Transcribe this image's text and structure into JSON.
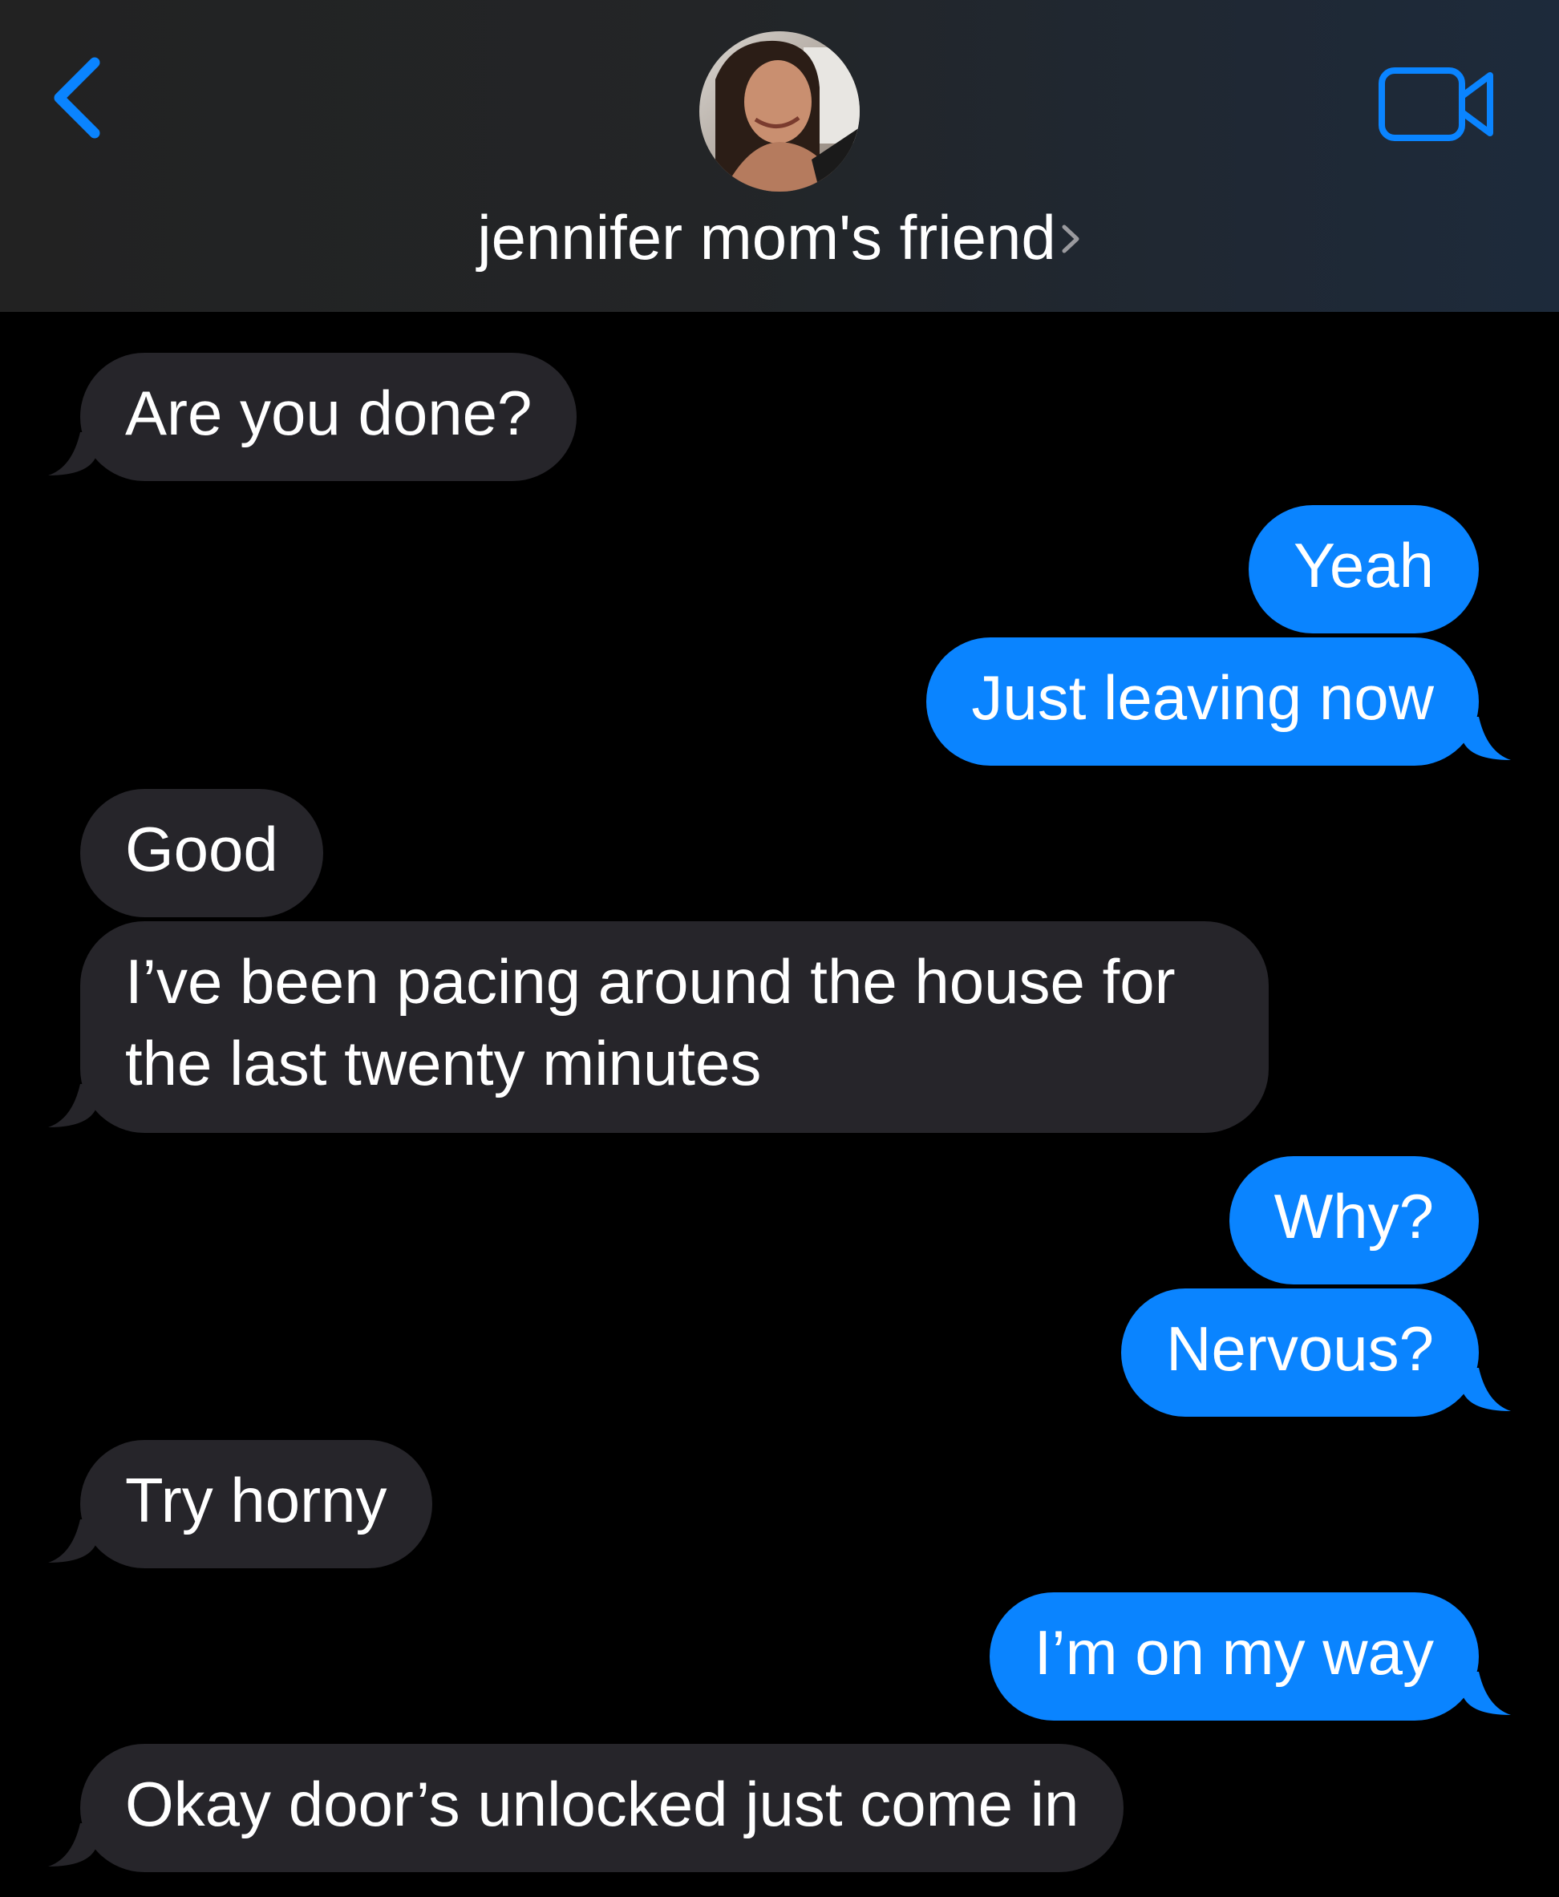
{
  "header": {
    "contact_name": "jennifer mom's friend",
    "back_icon": "chevron-left-icon",
    "video_icon": "video-camera-icon",
    "accent_color": "#0a84ff"
  },
  "messages": [
    {
      "direction": "incoming",
      "text": "Are you done?"
    },
    {
      "direction": "outgoing",
      "text": "Yeah"
    },
    {
      "direction": "outgoing",
      "text": "Just leaving now"
    },
    {
      "direction": "incoming",
      "text": "Good"
    },
    {
      "direction": "incoming",
      "text": "I’ve been pacing around the house for the last twenty minutes"
    },
    {
      "direction": "outgoing",
      "text": "Why?"
    },
    {
      "direction": "outgoing",
      "text": "Nervous?"
    },
    {
      "direction": "incoming",
      "text": "Try horny"
    },
    {
      "direction": "outgoing",
      "text": "I’m on my way"
    },
    {
      "direction": "incoming",
      "text": "Okay door’s unlocked just come in"
    }
  ],
  "colors": {
    "incoming_bubble": "#26252a",
    "outgoing_bubble": "#0a84ff",
    "background": "#000000"
  }
}
